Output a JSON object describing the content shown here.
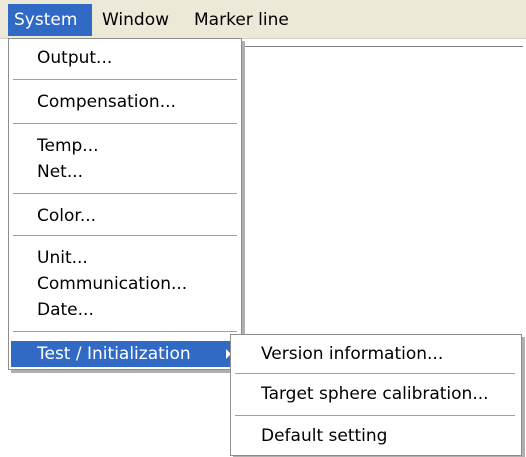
{
  "menubar": {
    "system": "System",
    "window": "Window",
    "marker_line": "Marker line"
  },
  "system_menu": {
    "output": "Output...",
    "compensation": "Compensation...",
    "temp": "Temp...",
    "net": "Net...",
    "color": "Color...",
    "unit": "Unit...",
    "communication": "Communication...",
    "date": "Date...",
    "test_initialization": "Test / Initialization"
  },
  "submenu": {
    "version_information": "Version information...",
    "target_sphere_calibration": "Target sphere calibration...",
    "default_setting": "Default setting"
  },
  "colors": {
    "highlight": "#316ac5",
    "menubar_bg": "#ece9d8"
  }
}
